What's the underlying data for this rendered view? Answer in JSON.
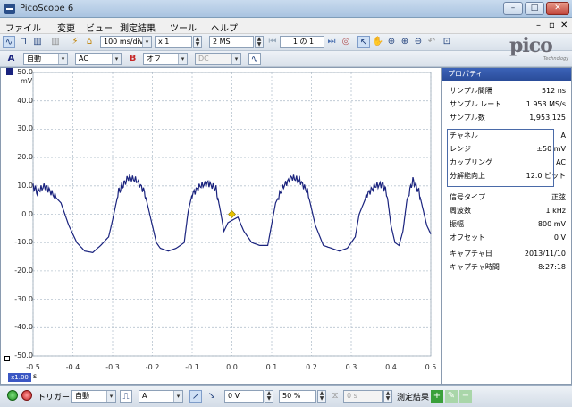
{
  "window": {
    "title": "PicoScope 6"
  },
  "menu": [
    "ファイル",
    "変更",
    "ビュー",
    "測定結果",
    "ツール",
    "ヘルプ"
  ],
  "toolbar": {
    "timebase": "100 ms/div",
    "zoom": "x 1",
    "samples": "2 MS",
    "buffer": "1 の 1"
  },
  "channel_a": {
    "label": "A",
    "range": "自動",
    "coupling": "AC",
    "color": "#1a237e"
  },
  "channel_b": {
    "label": "B",
    "state": "オフ",
    "coupling": "DC",
    "color": "#c62828"
  },
  "plot": {
    "y_unit": "mV",
    "x_unit": "s",
    "zoom_badge": "x1.00",
    "trigger_color": "#e6c200"
  },
  "chart_data": {
    "type": "line",
    "title": "",
    "xlabel": "s",
    "ylabel": "mV",
    "xlim": [
      -0.5,
      0.5
    ],
    "ylim": [
      -50,
      50
    ],
    "x_ticks": [
      "-0.5",
      "-0.4",
      "-0.3",
      "-0.2",
      "-0.1",
      "0.0",
      "0.1",
      "0.2",
      "0.3",
      "0.4",
      "0.5"
    ],
    "y_ticks": [
      "50.0",
      "40.0",
      "30.0",
      "20.0",
      "10.0",
      "0.0",
      "-10.0",
      "-20.0",
      "-30.0",
      "-40.0",
      "-50.0"
    ],
    "grid": true,
    "series": [
      {
        "values": [
          [
            -0.5,
            10
          ],
          [
            -0.49,
            8
          ],
          [
            -0.47,
            10
          ],
          [
            -0.45,
            7
          ],
          [
            -0.43,
            4
          ],
          [
            -0.41,
            -4
          ],
          [
            -0.39,
            -10
          ],
          [
            -0.37,
            -13
          ],
          [
            -0.35,
            -13.5
          ],
          [
            -0.33,
            -11
          ],
          [
            -0.31,
            -8
          ],
          [
            -0.3,
            -2
          ],
          [
            -0.285,
            8
          ],
          [
            -0.275,
            10
          ],
          [
            -0.26,
            13
          ],
          [
            -0.24,
            12
          ],
          [
            -0.22,
            8
          ],
          [
            -0.21,
            2
          ],
          [
            -0.2,
            -4
          ],
          [
            -0.19,
            -10
          ],
          [
            -0.18,
            -12
          ],
          [
            -0.16,
            -13
          ],
          [
            -0.14,
            -12
          ],
          [
            -0.12,
            -10
          ],
          [
            -0.11,
            1
          ],
          [
            -0.1,
            7
          ],
          [
            -0.08,
            10
          ],
          [
            -0.06,
            11
          ],
          [
            -0.04,
            9
          ],
          [
            -0.03,
            2
          ],
          [
            -0.02,
            -6
          ],
          [
            -0.01,
            -3
          ],
          [
            0.015,
            -1
          ],
          [
            0.03,
            -6
          ],
          [
            0.05,
            -10
          ],
          [
            0.07,
            -11
          ],
          [
            0.09,
            -11
          ],
          [
            0.11,
            4
          ],
          [
            0.13,
            10
          ],
          [
            0.15,
            13
          ],
          [
            0.17,
            12
          ],
          [
            0.19,
            8
          ],
          [
            0.21,
            -4
          ],
          [
            0.23,
            -11
          ],
          [
            0.25,
            -12
          ],
          [
            0.27,
            -13
          ],
          [
            0.29,
            -12
          ],
          [
            0.31,
            -8
          ],
          [
            0.32,
            0
          ],
          [
            0.34,
            7
          ],
          [
            0.36,
            10
          ],
          [
            0.38,
            10.5
          ],
          [
            0.39,
            7
          ],
          [
            0.4,
            -4
          ],
          [
            0.41,
            -10
          ],
          [
            0.42,
            -11
          ],
          [
            0.43,
            -6
          ],
          [
            0.44,
            5
          ],
          [
            0.455,
            12
          ],
          [
            0.47,
            8
          ],
          [
            0.48,
            2
          ],
          [
            0.49,
            -4
          ],
          [
            0.5,
            -7
          ]
        ]
      }
    ]
  },
  "properties": {
    "header": "プロパティ",
    "rows": [
      {
        "key": "サンプル間隔",
        "value": "512 ns"
      },
      {
        "key": "サンプル レート",
        "value": "1.953 MS/s"
      },
      {
        "key": "サンプル数",
        "value": "1,953,125"
      }
    ],
    "channel_rows": [
      {
        "key": "チャネル",
        "value": "A"
      },
      {
        "key": "レンジ",
        "value": "±50 mV"
      },
      {
        "key": "カップリング",
        "value": "AC"
      },
      {
        "key": "分解能向上",
        "value": "12.0 ビット"
      }
    ],
    "signal_rows": [
      {
        "key": "信号タイプ",
        "value": "正弦"
      },
      {
        "key": "周波数",
        "value": "1 kHz"
      },
      {
        "key": "振幅",
        "value": "800 mV"
      },
      {
        "key": "オフセット",
        "value": "0 V"
      }
    ],
    "capture_rows": [
      {
        "key": "キャプチャ日",
        "value": "2013/11/10"
      },
      {
        "key": "キャプチャ時間",
        "value": "8:27:18"
      }
    ]
  },
  "bottom": {
    "trigger_label": "トリガー",
    "trigger_mode": "自動",
    "trigger_source": "A",
    "trigger_level": "0 V",
    "pre_trigger": "50 %",
    "delay": "0 s",
    "measurements_label": "測定結果"
  },
  "logo": {
    "text": "pico",
    "sub": "Technology"
  }
}
